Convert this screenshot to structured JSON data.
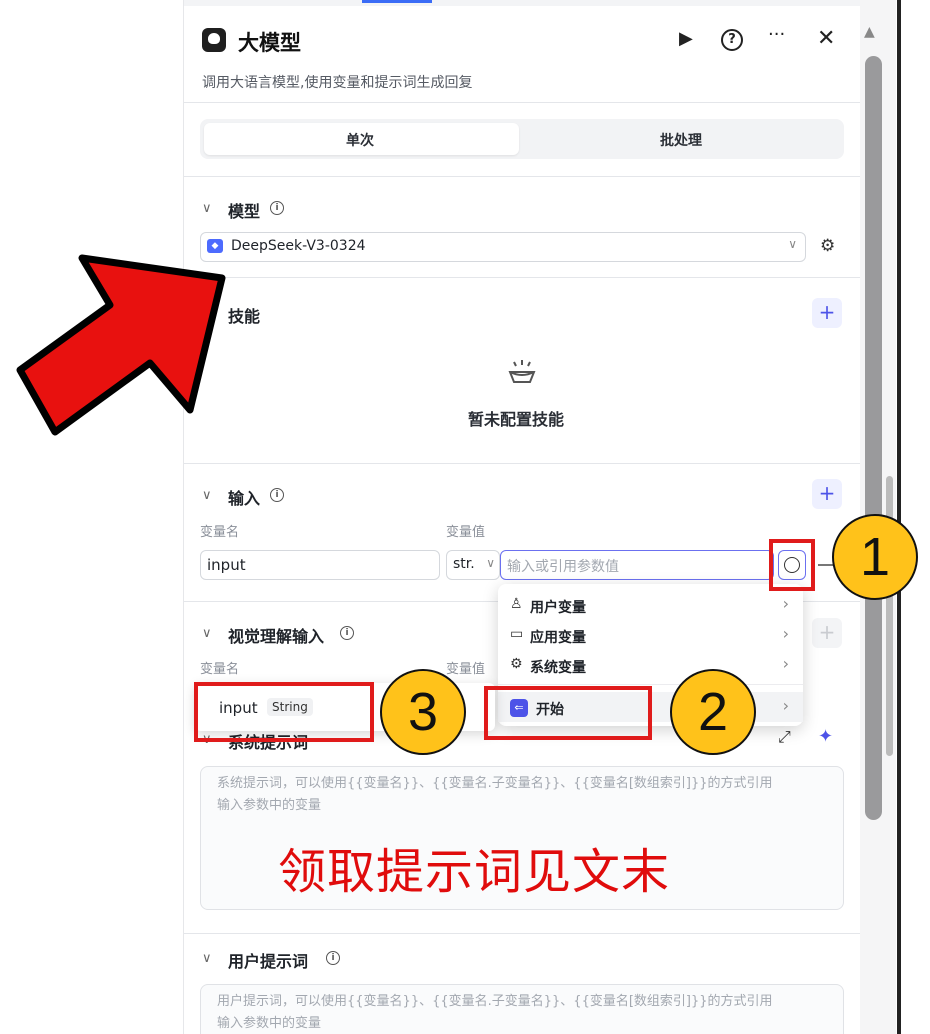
{
  "header": {
    "title": "大模型",
    "subtitle": "调用大语言模型,使用变量和提示词生成回复"
  },
  "tabs": {
    "single": "单次",
    "batch": "批处理"
  },
  "model_section": {
    "title": "模型",
    "selected_model": "DeepSeek-V3-0324"
  },
  "skills_section": {
    "title": "技能",
    "empty_text": "暂未配置技能"
  },
  "input_section": {
    "title": "输入",
    "col_name": "变量名",
    "col_value": "变量值",
    "row": {
      "name": "input",
      "type": "str.",
      "value_placeholder": "输入或引用参数值"
    }
  },
  "vision_section": {
    "title": "视觉理解输入",
    "col_name": "变量名",
    "col_value": "变量值"
  },
  "variable_menu": {
    "items": [
      {
        "label": "用户变量",
        "icon": "user-icon"
      },
      {
        "label": "应用变量",
        "icon": "folder-icon"
      },
      {
        "label": "系统变量",
        "icon": "gear-icon"
      },
      {
        "label": "开始",
        "icon": "start-node-icon"
      }
    ]
  },
  "variable_popup": {
    "name": "input",
    "type": "String"
  },
  "system_prompt": {
    "title": "系统提示词",
    "placeholder_line1": "系统提示词，可以使用{{变量名}}、{{变量名.子变量名}}、{{变量名[数组索引]}}的方式引用",
    "placeholder_line2": "输入参数中的变量"
  },
  "user_prompt": {
    "title": "用户提示词",
    "placeholder_line1": "用户提示词，可以使用{{变量名}}、{{变量名.子变量名}}、{{变量名[数组索引]}}的方式引用",
    "placeholder_line2": "输入参数中的变量"
  },
  "annotations": {
    "badge1": "1",
    "badge2": "2",
    "badge3": "3",
    "caption": "领取提示词见文末",
    "arrow_color": "#e8110f",
    "highlight_color": "#e01b1b",
    "badge_color": "#ffc21a"
  },
  "colors": {
    "accent": "#4d53e8",
    "brand_model": "#4d6bfe"
  }
}
